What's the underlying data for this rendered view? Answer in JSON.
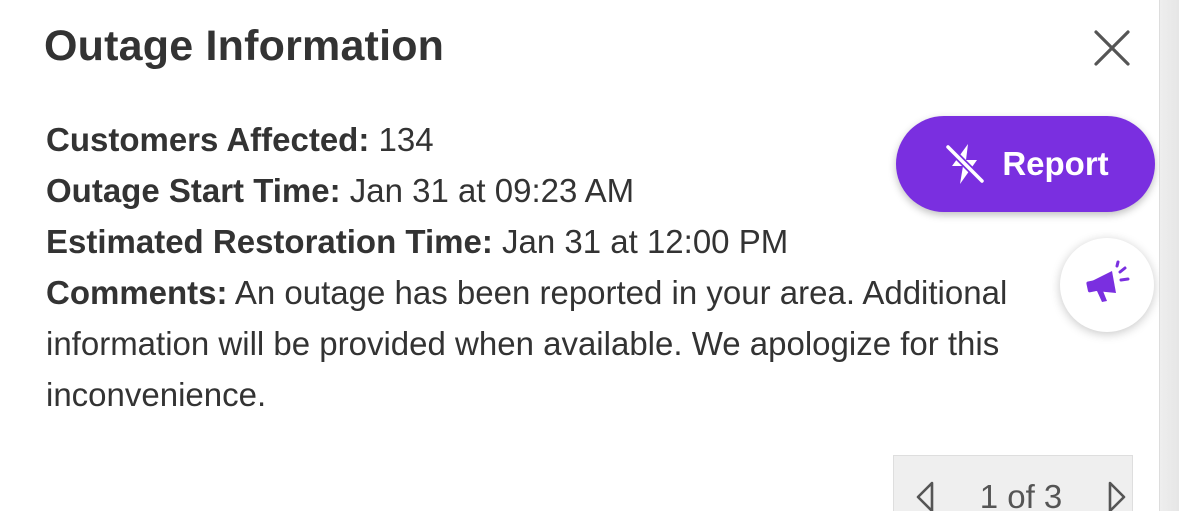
{
  "dialog": {
    "title": "Outage Information",
    "close_icon": "close-icon"
  },
  "details": {
    "customers_affected": {
      "label": "Customers Affected:",
      "value": "134"
    },
    "start_time": {
      "label": "Outage Start Time:",
      "value": "Jan 31 at 09:23 AM"
    },
    "restoration_time": {
      "label": "Estimated Restoration Time:",
      "value": "Jan 31 at 12:00 PM"
    },
    "comments": {
      "label": "Comments:",
      "value": "An outage has been reported in your area. Additional information will be provided when available. We apologize for this inconvenience."
    }
  },
  "actions": {
    "report_label": "Report",
    "report_icon": "lightning-off-icon",
    "announce_icon": "megaphone-icon"
  },
  "pager": {
    "text": "1 of 3",
    "prev_icon": "chevron-left-icon",
    "next_icon": "chevron-right-icon"
  },
  "colors": {
    "accent": "#7a2fe0",
    "text": "#333333",
    "background": "#ffffff"
  }
}
